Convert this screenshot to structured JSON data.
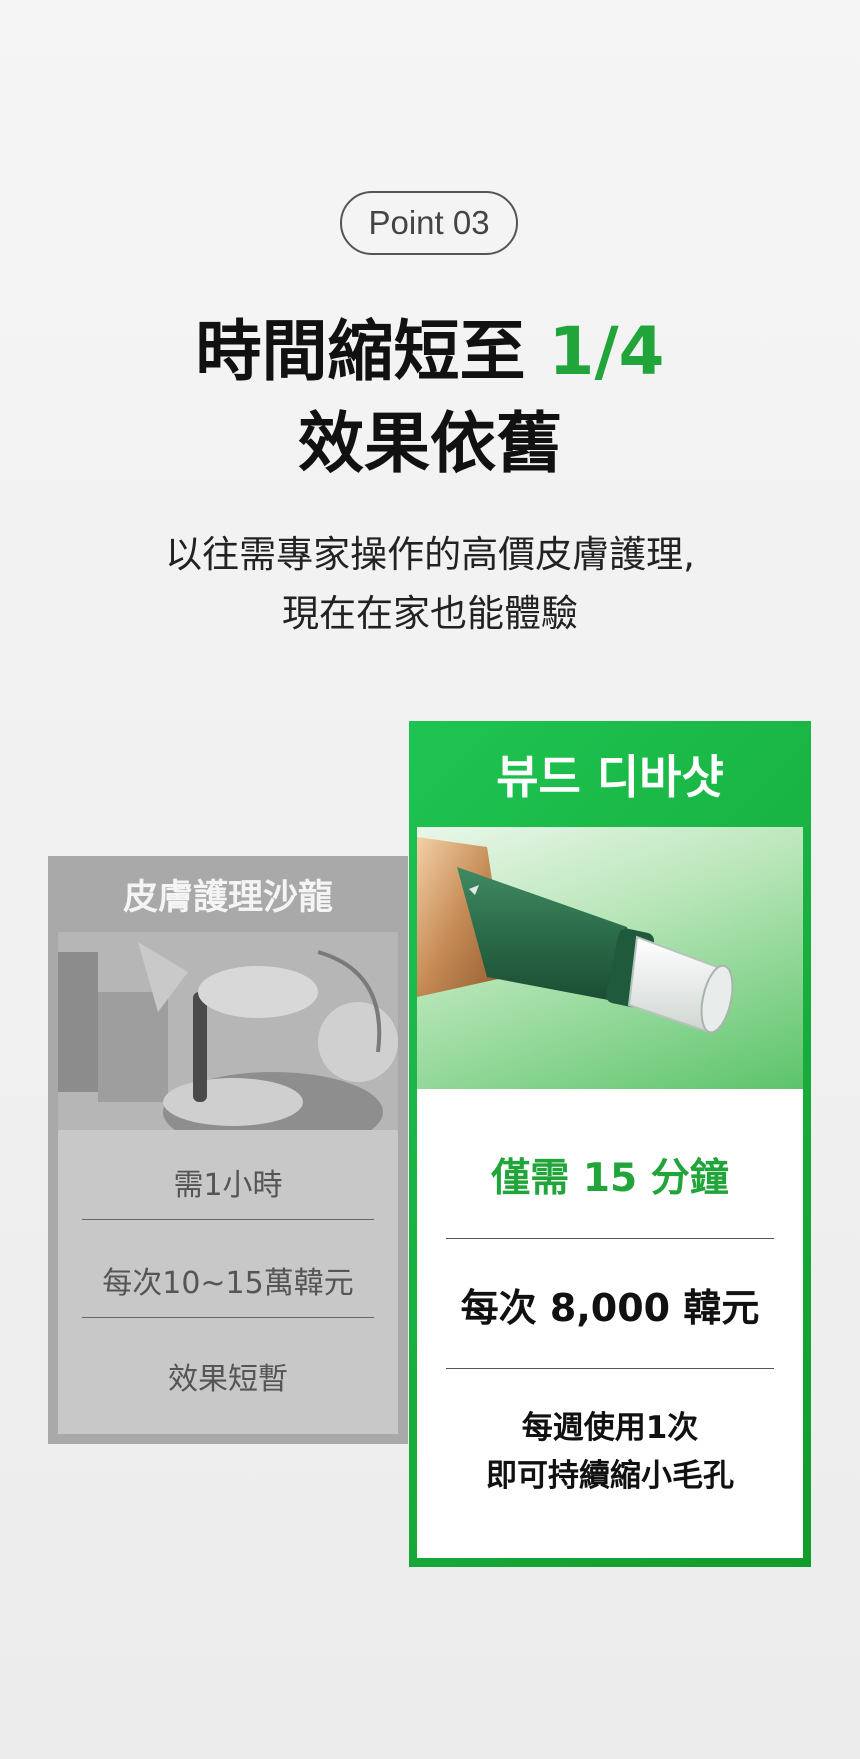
{
  "badge": "Point 03",
  "headline": {
    "line1_main": "時間縮短至 ",
    "line1_accent": "1/4",
    "line2": "效果依舊"
  },
  "subtitle": {
    "line1": "以往需專家操作的高價皮膚護理,",
    "line2": "現在在家也能體驗"
  },
  "salon": {
    "title": "皮膚護理沙龍",
    "time": "需1小時",
    "price": "每次10~15萬韓元",
    "effect": "效果短暫"
  },
  "product": {
    "title": "뷰드 디바샷",
    "time": "僅需 15 分鐘",
    "price": "每次 8,000 韓元",
    "usage_line1": "每週使用1次",
    "usage_line2": "即可持續縮小毛孔"
  },
  "colors": {
    "accent_green": "#21a53a",
    "card_green": "#119b2c",
    "device_green": "#2b6e4a"
  }
}
